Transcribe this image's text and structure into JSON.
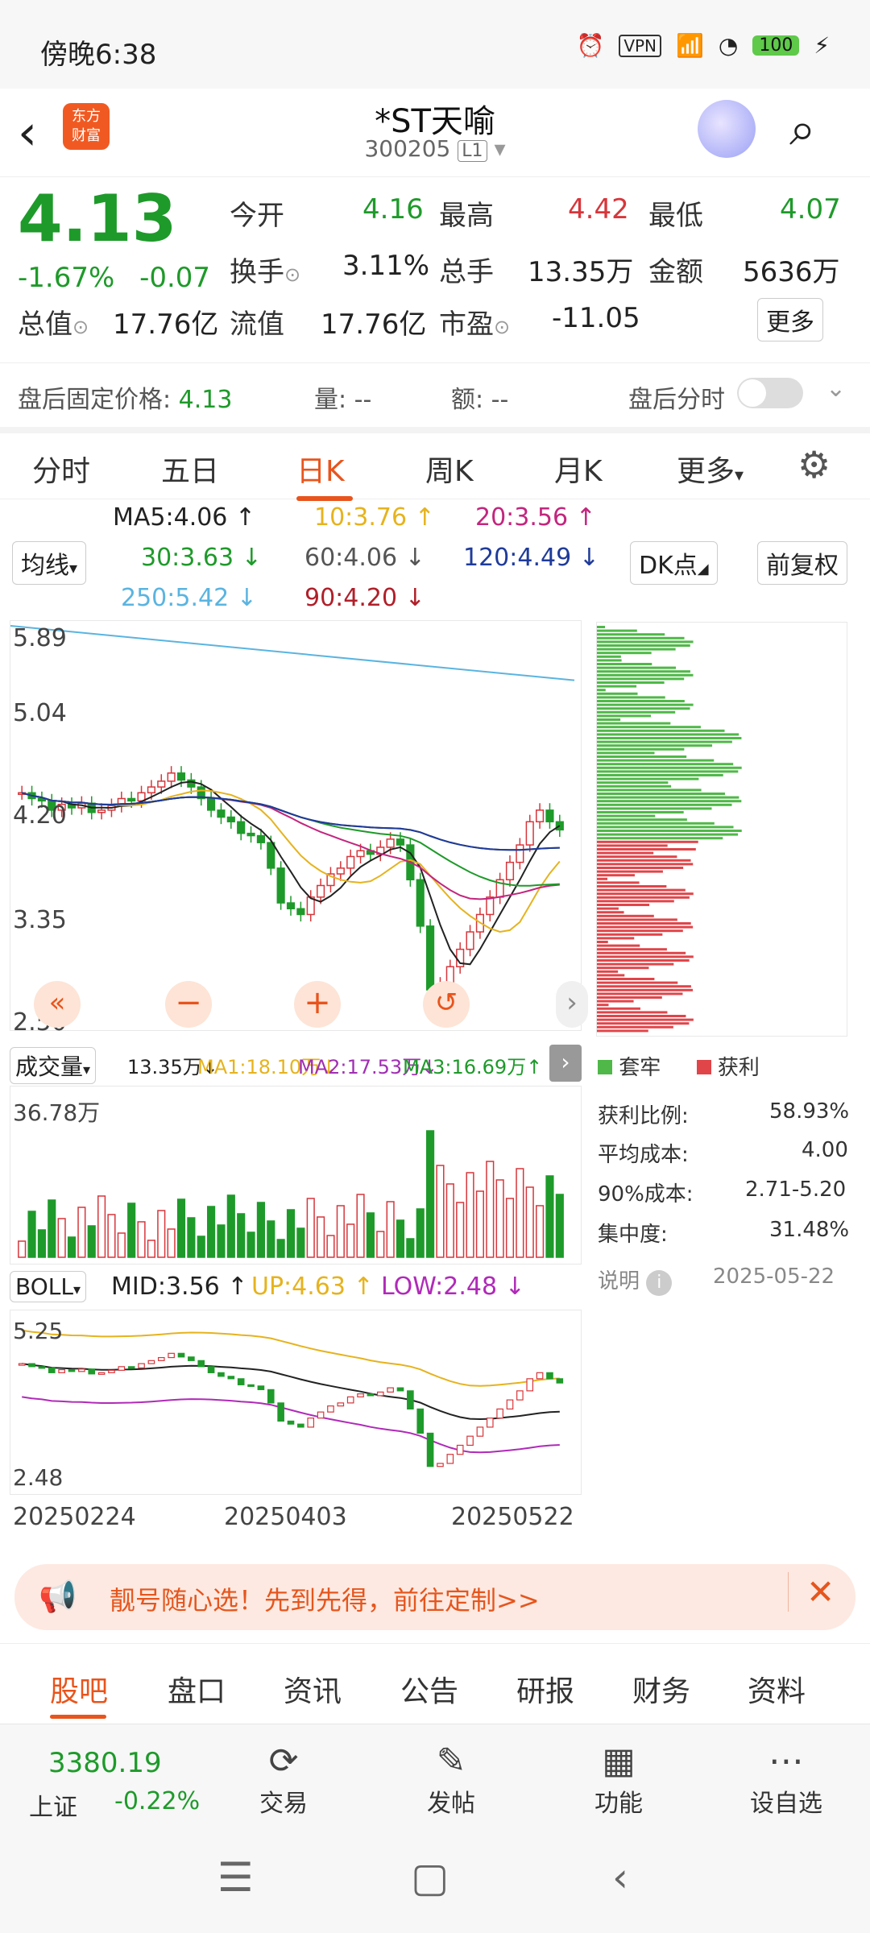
{
  "status": {
    "time": "傍晚6:38",
    "vpn": "VPN",
    "battery": "100"
  },
  "header": {
    "logo_line1": "东方",
    "logo_line2": "财富",
    "title": "*ST天喻",
    "code": "300205",
    "level": "L1"
  },
  "quote": {
    "price": "4.13",
    "change_pct": "-1.67%",
    "change": "-0.07",
    "open_label": "今开",
    "open": "4.16",
    "high_label": "最高",
    "high": "4.42",
    "low_label": "最低",
    "low": "4.07",
    "turnover_label": "换手",
    "turnover": "3.11%",
    "volume_label": "总手",
    "volume": "13.35万",
    "amount_label": "金额",
    "amount": "5636万",
    "mktcap_label": "总值",
    "mktcap": "17.76亿",
    "float_label": "流值",
    "float": "17.76亿",
    "pe_label": "市盈",
    "pe": "-11.05",
    "more": "更多"
  },
  "after_hours": {
    "label": "盘后固定价格:",
    "price": "4.13",
    "vol_label": "量:",
    "vol": "--",
    "amt_label": "额:",
    "amt": "--",
    "toggle_label": "盘后分时"
  },
  "tabs": [
    "分时",
    "五日",
    "日K",
    "周K",
    "月K",
    "更多"
  ],
  "ma": {
    "ma5": "MA5:4.06 ↑",
    "ma10": "10:3.76 ↑",
    "ma20": "20:3.56 ↑",
    "ma30": "30:3.63 ↓",
    "ma60": "60:4.06 ↓",
    "ma120": "120:4.49 ↓",
    "ma250": "250:5.42 ↓",
    "ma90": "90:4.20 ↓",
    "avg_btn": "均线",
    "dk_btn": "DK点",
    "fq_btn": "前复权"
  },
  "kline_axis": [
    "5.89",
    "5.04",
    "4.20",
    "3.35",
    "2.50"
  ],
  "volume": {
    "selector": "成交量",
    "value": "13.35万↓",
    "ma1": "MA1:18.10万↓",
    "ma2": "MA2:17.53万↓",
    "ma3": "MA3:16.69万↑",
    "max": "36.78万"
  },
  "boll": {
    "selector": "BOLL",
    "mid": "MID:3.56 ↑",
    "up": "UP:4.63 ↑",
    "low": "LOW:2.48 ↓",
    "top": "5.25",
    "bottom": "2.48"
  },
  "dates": [
    "20250224",
    "20250403",
    "20250522"
  ],
  "chip": {
    "legend_trapped": "套牢",
    "legend_profit": "获利",
    "profit_ratio_label": "获利比例:",
    "profit_ratio": "58.93%",
    "avg_cost_label": "平均成本:",
    "avg_cost": "4.00",
    "cost90_label": "90%成本:",
    "cost90": "2.71-5.20",
    "concentration_label": "集中度:",
    "concentration": "31.48%",
    "note": "说明",
    "date": "2025-05-22"
  },
  "banner": {
    "text": "靓号随心选！先到先得，前往定制>>"
  },
  "bottom_tabs": [
    "股吧",
    "盘口",
    "资讯",
    "公告",
    "研报",
    "财务",
    "资料"
  ],
  "index": {
    "value": "3380.19",
    "name": "上证",
    "change": "-0.22%"
  },
  "tools": [
    "交易",
    "发帖",
    "功能",
    "设自选"
  ],
  "colors": {
    "up": "#d7363b",
    "down": "#1e9a2a",
    "accent": "#e8541c"
  },
  "chart_data": {
    "type": "candlestick",
    "ylim": [
      2.5,
      5.89
    ],
    "close": [
      4.45,
      4.4,
      4.38,
      4.3,
      4.35,
      4.32,
      4.36,
      4.28,
      4.3,
      4.34,
      4.4,
      4.38,
      4.45,
      4.5,
      4.55,
      4.62,
      4.56,
      4.5,
      4.4,
      4.3,
      4.24,
      4.2,
      4.1,
      4.08,
      4.02,
      3.8,
      3.5,
      3.45,
      3.4,
      3.55,
      3.65,
      3.75,
      3.8,
      3.9,
      3.95,
      3.92,
      3.98,
      4.05,
      4.0,
      3.7,
      3.3,
      2.75,
      2.8,
      2.95,
      3.1,
      3.25,
      3.4,
      3.55,
      3.7,
      3.85,
      4.0,
      4.2,
      4.3,
      4.2,
      4.13
    ]
  }
}
